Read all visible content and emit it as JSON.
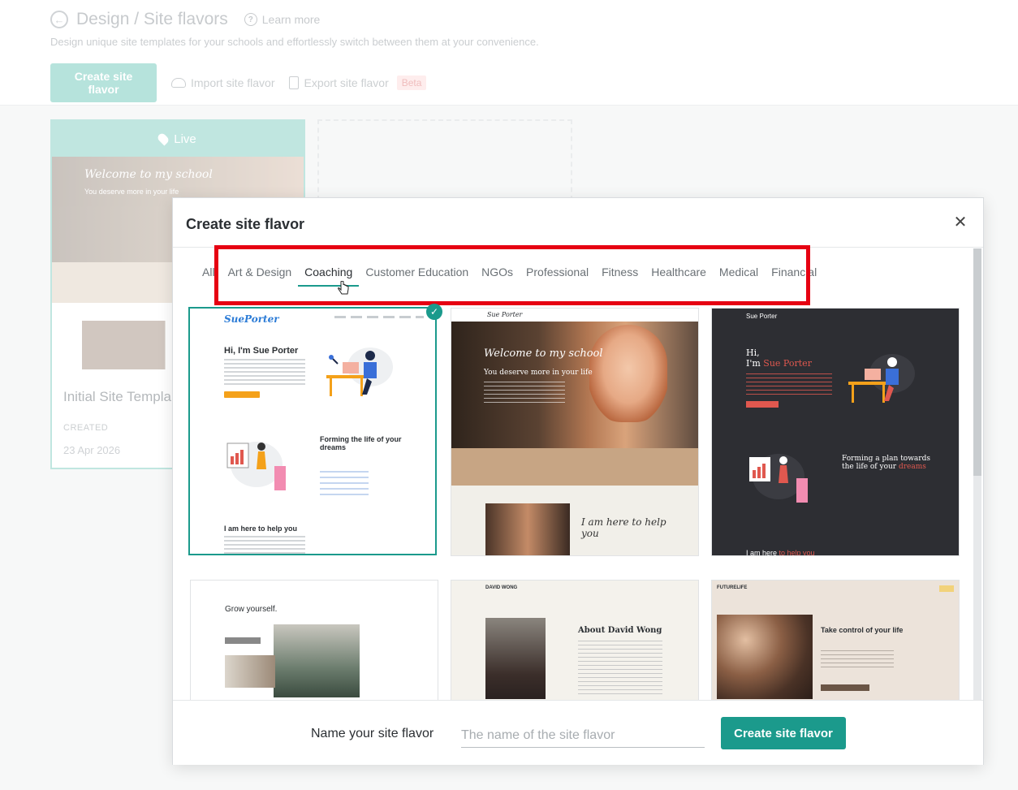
{
  "page": {
    "breadcrumb": "Design / Site flavors",
    "learn_more": "Learn more",
    "subtitle": "Design unique site templates for your schools and effortlessly switch between them at your convenience.",
    "actions": {
      "create": "Create site flavor",
      "import": "Import site flavor",
      "export": "Export site flavor",
      "export_badge": "Beta"
    },
    "live_card": {
      "status": "Live",
      "name": "Initial Site Templa",
      "created_label": "CREATED",
      "created_date": "23 Apr 2026",
      "preview_title": "Welcome to my school",
      "preview_subtitle": "You deserve more in your life"
    }
  },
  "modal": {
    "title": "Create site flavor",
    "close_icon": "close-icon",
    "tabs": [
      {
        "label": "All"
      },
      {
        "label": "Art & Design"
      },
      {
        "label": "Coaching"
      },
      {
        "label": "Customer Education"
      },
      {
        "label": "NGOs"
      },
      {
        "label": "Professional"
      },
      {
        "label": "Fitness"
      },
      {
        "label": "Healthcare"
      },
      {
        "label": "Medical"
      },
      {
        "label": "Financial"
      }
    ],
    "active_tab": "Coaching",
    "templates": [
      {
        "logo": "SuePorter",
        "heading": "Hi, I'm Sue Porter",
        "heading2": "Forming the life of your dreams",
        "heading3": "I am here to help you",
        "selected": true
      },
      {
        "logo": "Sue Porter",
        "heading": "Welcome to my school",
        "subheading": "You deserve more in your life",
        "script": "I am here to help you"
      },
      {
        "logo": "Sue Porter",
        "heading_prefix": "Hi,",
        "heading_mid": "I'm ",
        "heading_name": "Sue Porter",
        "heading2": "Forming a plan towards the life of your ",
        "heading2_accent": "dreams",
        "heading3": "I am here ",
        "heading3_accent": "to help you"
      },
      {
        "heading": "Grow yourself."
      },
      {
        "logo": "DAVID WONG",
        "heading": "About David Wong"
      },
      {
        "logo": "FUTURELIFE",
        "heading": "Take control of your life"
      }
    ],
    "footer": {
      "label": "Name your site flavor",
      "input_placeholder": "The name of the site flavor",
      "input_value": "",
      "submit": "Create site flavor"
    }
  },
  "colors": {
    "accent": "#1b9a8c",
    "highlight": "#e60012",
    "sidebar_fade": "#9fd9d0"
  }
}
